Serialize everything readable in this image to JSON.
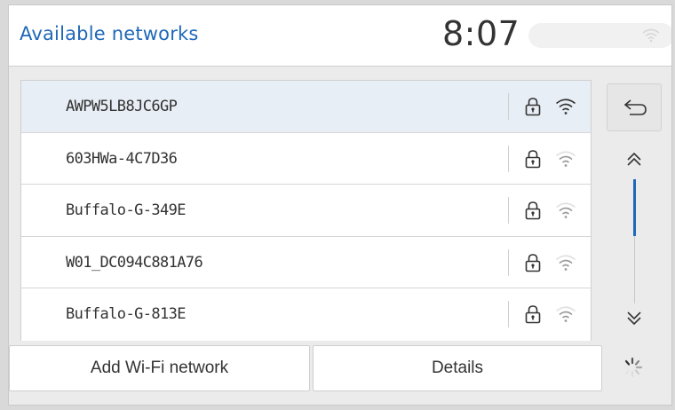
{
  "header": {
    "title": "Available networks",
    "clock": "8:07",
    "status_icon": "wifi-icon"
  },
  "networks": [
    {
      "ssid": "AWPW5LB8JC6GP",
      "secured": true,
      "signal_bars": 3,
      "selected": true
    },
    {
      "ssid": "603HWa-4C7D36",
      "secured": true,
      "signal_bars": 2,
      "selected": false
    },
    {
      "ssid": "Buffalo-G-349E",
      "secured": true,
      "signal_bars": 2,
      "selected": false
    },
    {
      "ssid": "W01_DC094C881A76",
      "secured": true,
      "signal_bars": 2,
      "selected": false
    },
    {
      "ssid": "Buffalo-G-813E",
      "secured": true,
      "signal_bars": 2,
      "selected": false
    }
  ],
  "side_controls": {
    "back_icon": "back-arrow-icon",
    "scroll_up_icon": "chevron-double-up-icon",
    "scroll_down_icon": "chevron-double-down-icon",
    "scroll_position_fraction": 0.35
  },
  "buttons": {
    "add_network": "Add Wi-Fi network",
    "details": "Details"
  },
  "colors": {
    "accent": "#1f68b8",
    "background": "#ebebeb",
    "surface": "#ffffff",
    "selected_row": "#e8eef5",
    "icon_active": "#333333",
    "icon_dim": "#9a9a9a"
  }
}
